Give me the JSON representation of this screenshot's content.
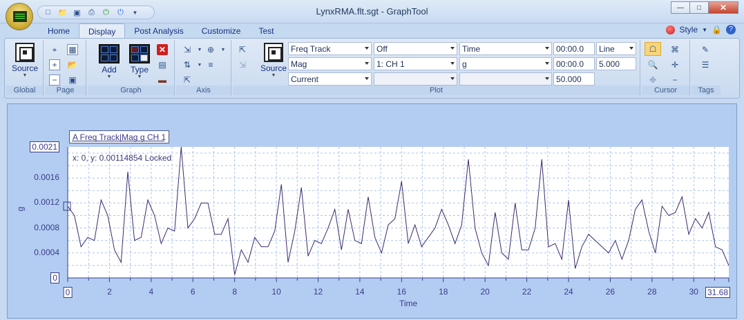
{
  "window": {
    "title": "LynxRMA.flt.sgt - GraphTool"
  },
  "qat": {
    "icons": [
      "new-icon",
      "open-icon",
      "save-icon",
      "print-icon",
      "power-green-icon",
      "power-blue-icon",
      "dropdown-icon"
    ]
  },
  "tabs": [
    "Home",
    "Display",
    "Post Analysis",
    "Customize",
    "Test"
  ],
  "active_tab": "Display",
  "style_menu": {
    "label": "Style"
  },
  "ribbon": {
    "groups": {
      "global": "Global",
      "page": "Page",
      "graph": "Graph",
      "axis": "Axis",
      "plot": "Plot",
      "cursor": "Cursor",
      "tags": "Tags"
    },
    "global_source": "Source",
    "graph_add": "Add",
    "graph_type": "Type",
    "plot_source": "Source",
    "plot_rows": [
      {
        "col1": "Freq Track",
        "col2": "Off",
        "col3": "Time",
        "col4": "00:00.0",
        "col5": "Line"
      },
      {
        "col1": "Mag",
        "col2": "1: CH 1",
        "col3": "g",
        "col4": "00:00.0",
        "col5": "5.000"
      },
      {
        "col1": "Current",
        "col2": "",
        "col3": "",
        "col4": "50.000",
        "col5": ""
      }
    ]
  },
  "plot": {
    "legend": "A Freq Track|Mag g CH 1",
    "cursor_readout": "x: 0, y: 0.00114854 Locked",
    "y_ticks": [
      "0.0021",
      "0.0016",
      "0.0012",
      "0.0008",
      "0.0004",
      "0"
    ],
    "x_ticks": [
      "0",
      "2",
      "4",
      "6",
      "8",
      "10",
      "12",
      "14",
      "16",
      "18",
      "20",
      "22",
      "24",
      "26",
      "28",
      "30",
      "31.68"
    ],
    "line_color": "#3a2a6e",
    "grid_color": "#a9c3f0"
  },
  "chart_data": {
    "type": "line",
    "title": "",
    "xlabel": "Time",
    "ylabel": "g",
    "xlim": [
      0,
      31.68
    ],
    "ylim": [
      0,
      0.0021
    ],
    "grid": true,
    "series": [
      {
        "name": "A Freq Track|Mag g CH 1",
        "x": [
          0,
          0.32,
          0.64,
          0.96,
          1.28,
          1.6,
          1.92,
          2.24,
          2.56,
          2.88,
          3.2,
          3.52,
          3.84,
          4.16,
          4.48,
          4.8,
          5.12,
          5.44,
          5.76,
          6.08,
          6.4,
          6.72,
          7.04,
          7.36,
          7.68,
          8.0,
          8.32,
          8.64,
          8.96,
          9.28,
          9.6,
          9.92,
          10.24,
          10.56,
          10.88,
          11.2,
          11.52,
          11.84,
          12.16,
          12.48,
          12.8,
          13.12,
          13.44,
          13.76,
          14.08,
          14.4,
          14.72,
          15.04,
          15.36,
          15.68,
          16.0,
          16.32,
          16.64,
          16.96,
          17.28,
          17.6,
          17.92,
          18.24,
          18.56,
          18.88,
          19.2,
          19.52,
          19.84,
          20.16,
          20.48,
          20.8,
          21.12,
          21.44,
          21.76,
          22.08,
          22.4,
          22.72,
          23.04,
          23.36,
          23.68,
          24.0,
          24.32,
          24.64,
          24.96,
          25.28,
          25.6,
          25.92,
          26.24,
          26.56,
          26.88,
          27.2,
          27.52,
          27.84,
          28.16,
          28.48,
          28.8,
          29.12,
          29.44,
          29.76,
          30.08,
          30.4,
          30.72,
          31.04,
          31.36,
          31.68
        ],
        "y": [
          0.00115,
          0.001,
          0.0005,
          0.00065,
          0.0006,
          0.00125,
          0.001,
          0.00045,
          0.00025,
          0.0017,
          0.0006,
          0.00065,
          0.00125,
          0.001,
          0.00055,
          0.0008,
          0.00075,
          0.0021,
          0.0008,
          0.00095,
          0.0012,
          0.0012,
          0.0007,
          0.0007,
          0.00095,
          5e-05,
          0.00045,
          0.00025,
          0.00065,
          0.0005,
          0.0005,
          0.00075,
          0.0015,
          0.00025,
          0.00075,
          0.00145,
          0.00035,
          0.0006,
          0.00055,
          0.0008,
          0.0011,
          0.00045,
          0.0011,
          0.0006,
          0.00055,
          0.0013,
          0.00065,
          0.0004,
          0.00085,
          0.00095,
          0.00155,
          0.00055,
          0.00085,
          0.0005,
          0.00065,
          0.0008,
          0.0011,
          0.00085,
          0.00055,
          0.00085,
          0.0019,
          0.0008,
          0.0004,
          0.0002,
          0.00105,
          0.0004,
          0.0003,
          0.0012,
          0.00045,
          0.00045,
          0.0008,
          0.0019,
          0.0005,
          0.00055,
          0.0003,
          0.00125,
          0.00015,
          0.0005,
          0.0007,
          0.0006,
          0.0005,
          0.0004,
          0.0006,
          0.0003,
          0.0006,
          0.0011,
          0.00125,
          0.00075,
          0.0004,
          0.00115,
          0.001,
          0.00105,
          0.0013,
          0.0007,
          0.00095,
          0.0008,
          0.00105,
          0.0005,
          0.00045,
          0.0002
        ]
      }
    ]
  }
}
